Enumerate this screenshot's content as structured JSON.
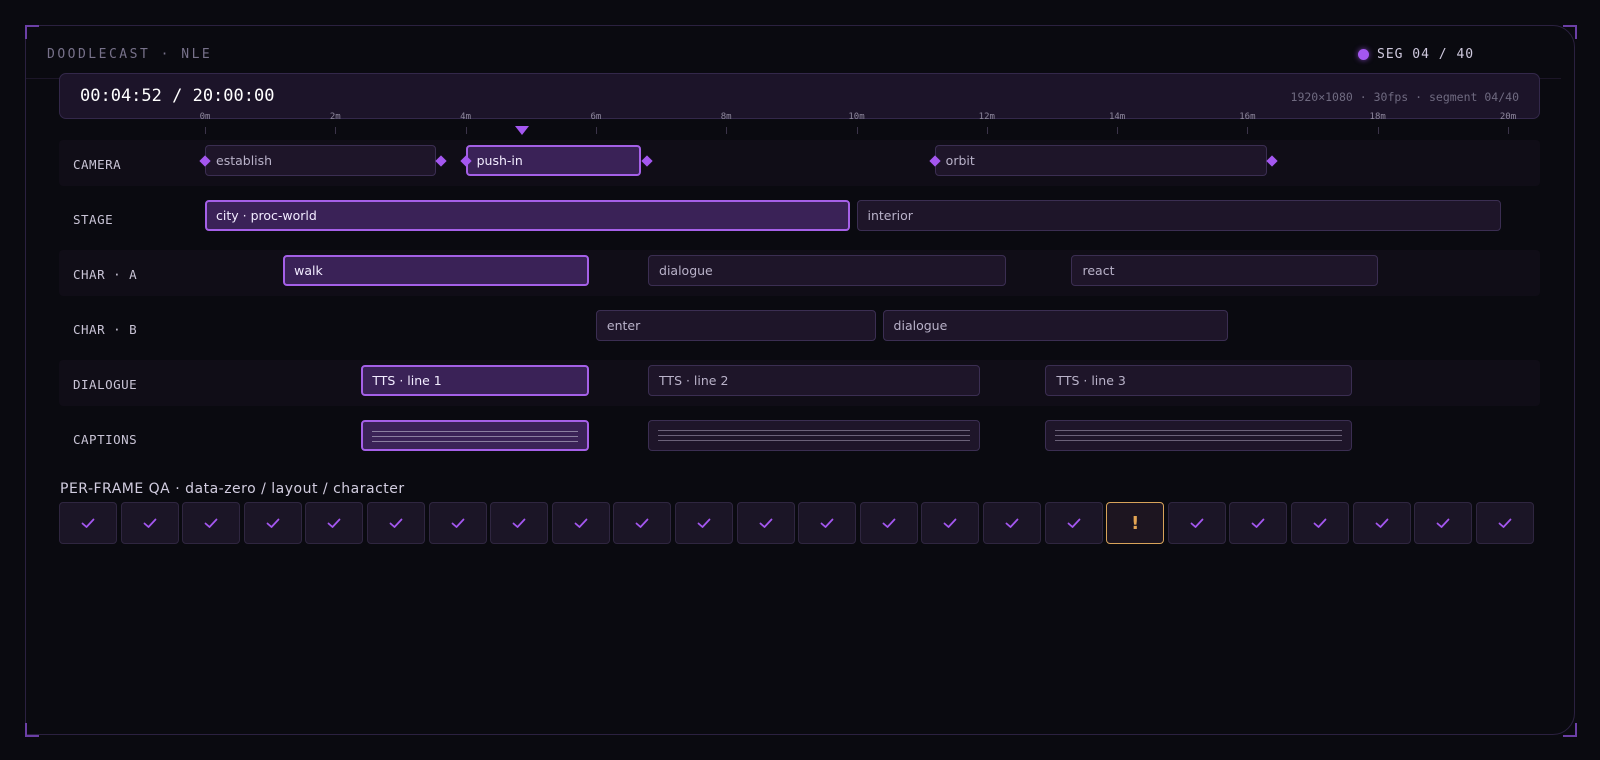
{
  "app": {
    "title": "DOODLECAST · NLE",
    "segment_badge": "SEG 04 / 40"
  },
  "transport": {
    "timecode": "00:04:52 / 20:00:00",
    "meta": "1920×1080 · 30fps · segment 04/40"
  },
  "ruler": {
    "labels": [
      "0m",
      "2m",
      "4m",
      "6m",
      "8m",
      "10m",
      "12m",
      "14m",
      "16m",
      "18m",
      "20m"
    ],
    "total_minutes": 20,
    "playhead_minutes": 4.87
  },
  "tracks": [
    {
      "id": "camera",
      "label": "CAMERA",
      "alt": true,
      "keyframes": true,
      "clips": [
        {
          "label": "establish",
          "start": 0,
          "end": 3.55,
          "active": false
        },
        {
          "label": "push-in",
          "start": 4.0,
          "end": 6.7,
          "active": true
        },
        {
          "label": "orbit",
          "start": 11.2,
          "end": 16.3,
          "active": false
        }
      ]
    },
    {
      "id": "stage",
      "label": "STAGE",
      "alt": false,
      "clips": [
        {
          "label": "city · proc-world",
          "start": 0,
          "end": 9.9,
          "active": true
        },
        {
          "label": "interior",
          "start": 10.0,
          "end": 19.9,
          "active": false
        }
      ]
    },
    {
      "id": "char-a",
      "label": "CHAR · A",
      "alt": true,
      "clips": [
        {
          "label": "walk",
          "start": 1.2,
          "end": 5.9,
          "active": true
        },
        {
          "label": "dialogue",
          "start": 6.8,
          "end": 12.3,
          "active": false
        },
        {
          "label": "react",
          "start": 13.3,
          "end": 18.0,
          "active": false
        }
      ]
    },
    {
      "id": "char-b",
      "label": "CHAR · B",
      "alt": false,
      "clips": [
        {
          "label": "enter",
          "start": 6.0,
          "end": 10.3,
          "active": false
        },
        {
          "label": "dialogue",
          "start": 10.4,
          "end": 15.7,
          "active": false
        }
      ]
    },
    {
      "id": "dialogue",
      "label": "DIALOGUE",
      "alt": true,
      "clips": [
        {
          "label": "TTS · line 1",
          "start": 2.4,
          "end": 5.9,
          "active": true
        },
        {
          "label": "TTS · line 2",
          "start": 6.8,
          "end": 11.9,
          "active": false
        },
        {
          "label": "TTS · line 3",
          "start": 12.9,
          "end": 17.6,
          "active": false
        }
      ]
    },
    {
      "id": "captions",
      "label": "CAPTIONS",
      "alt": false,
      "caption_lines": true,
      "clips": [
        {
          "label": "",
          "start": 2.4,
          "end": 5.9,
          "active": true
        },
        {
          "label": "",
          "start": 6.8,
          "end": 11.9,
          "active": false
        },
        {
          "label": "",
          "start": 12.9,
          "end": 17.6,
          "active": false
        }
      ]
    }
  ],
  "qa": {
    "title": "PER-FRAME QA · data-zero / layout / character",
    "cells": [
      "ok",
      "ok",
      "ok",
      "ok",
      "ok",
      "ok",
      "ok",
      "ok",
      "ok",
      "ok",
      "ok",
      "ok",
      "ok",
      "ok",
      "ok",
      "ok",
      "ok",
      "warn",
      "ok",
      "ok",
      "ok",
      "ok",
      "ok",
      "ok"
    ],
    "warn_glyph": "!"
  },
  "colors": {
    "accent": "#a457f0",
    "warn": "#e3a453"
  }
}
